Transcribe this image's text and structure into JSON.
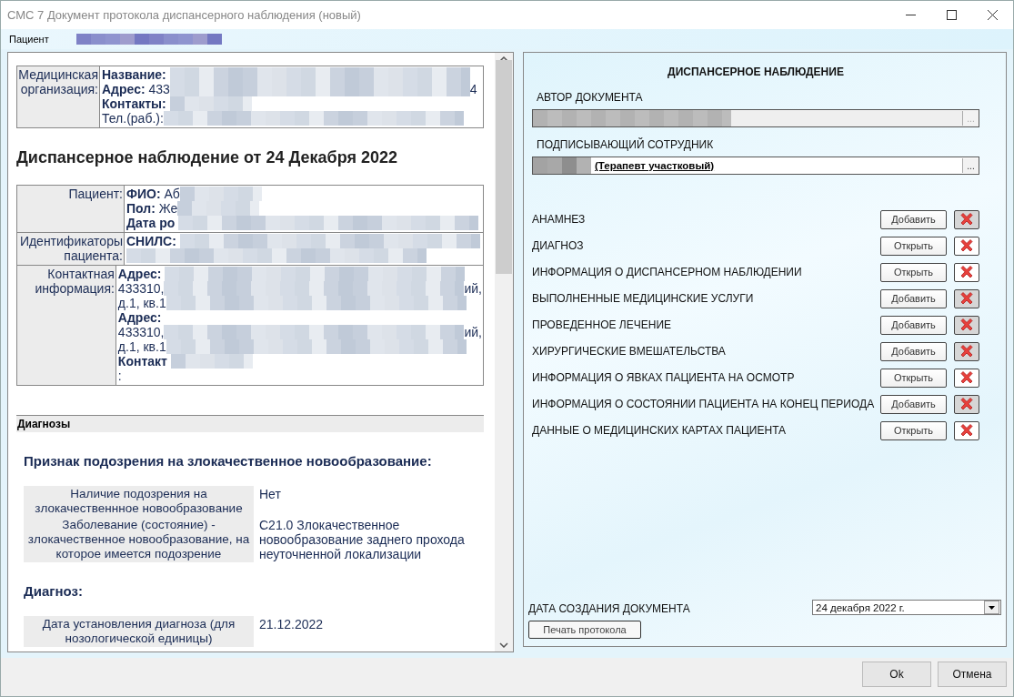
{
  "window": {
    "title": "СМС 7 Документ протокола диспансерного наблюдения (новый)"
  },
  "patient_bar": {
    "label": "Пациент",
    "name_redacted": true
  },
  "document": {
    "org_table": {
      "rows": [
        {
          "label": "Медицинская организация:",
          "lines": [
            {
              "key": "Название:",
              "redacted": true
            },
            {
              "key": "Адрес:",
              "text": "433",
              "redacted": true,
              "after": "4"
            },
            {
              "key": "Контакты:",
              "redacted": true,
              "narrow": true
            },
            {
              "text": "Тел.(раб.):",
              "redacted": true
            }
          ]
        }
      ]
    },
    "heading": "Диспансерное наблюдение от 24 Декабря 2022",
    "patient_table": {
      "rows": [
        {
          "label": "Пациент:",
          "lines": [
            {
              "key": "ФИО:",
              "text": "Аб",
              "redacted": true,
              "narrow": true
            },
            {
              "key": "Пол:",
              "text": "Же",
              "redacted": true,
              "narrow": true
            },
            {
              "key": "Дата ро",
              "redacted": true
            }
          ]
        },
        {
          "label": "Идентификаторы пациента:",
          "lines": [
            {
              "key": "СНИЛС:",
              "redacted": true
            },
            {
              "redacted": true
            }
          ]
        },
        {
          "label": "Контактная информация:",
          "lines": [
            {
              "key": "Адрес:",
              "redacted": true
            },
            {
              "text": "433310,",
              "redacted": true,
              "after": "ий,"
            },
            {
              "text": "д.1, кв.1",
              "redacted": true
            },
            {
              "key": "Адрес:",
              "redacted": false
            },
            {
              "text": "433310,",
              "redacted": true,
              "after": "ий,"
            },
            {
              "text": "д.1, кв.1",
              "redacted": true
            },
            {
              "key": "Контакт",
              "redacted": true,
              "narrow": true
            },
            {
              "text": ":",
              "redacted": false
            }
          ]
        }
      ]
    },
    "section_bar": "Диагнозы",
    "blocks": [
      {
        "title": "Признак подозрения на злокачественное новообразование:",
        "rows": [
          {
            "label": "Наличие подозрения на злокачественнное новообразование",
            "value": "Нет"
          },
          {
            "label": "Заболевание (состояние) - злокачественное новообразование, на которое имеется подозрение",
            "value": "C21.0 Злокачественное новообразование заднего прохода неуточненной локализации"
          }
        ]
      },
      {
        "title": "Диагноз:",
        "rows": [
          {
            "label": "Дата установления диагноза (для нозологической единицы)",
            "value": "21.12.2022"
          }
        ]
      }
    ]
  },
  "form": {
    "title": "ДИСПАНСЕРНОЕ НАБЛЮДЕНИЕ",
    "author": {
      "label": "АВТОР ДОКУМЕНТА",
      "browse": "...",
      "disabled": true
    },
    "signer": {
      "label": "ПОДПИСЫВАЮЩИЙ СОТРУДНИК",
      "value": "(Терапевт участковый)",
      "browse": "...",
      "disabled": false
    },
    "sections": [
      {
        "label": "АНАМНЕЗ",
        "action": "Добавить",
        "delete_disabled": true
      },
      {
        "label": "ДИАГНОЗ",
        "action": "Открыть",
        "delete_disabled": false
      },
      {
        "label": "ИНФОРМАЦИЯ О ДИСПАНСЕРНОМ НАБЛЮДЕНИИ",
        "action": "Открыть",
        "delete_disabled": false
      },
      {
        "label": "ВЫПОЛНЕННЫЕ МЕДИЦИНСКИЕ УСЛУГИ",
        "action": "Добавить",
        "delete_disabled": true
      },
      {
        "label": "ПРОВЕДЕННОЕ ЛЕЧЕНИЕ",
        "action": "Добавить",
        "delete_disabled": true
      },
      {
        "label": "ХИРУРГИЧЕСКИЕ ВМЕШАТЕЛЬСТВА",
        "action": "Добавить",
        "delete_disabled": true
      },
      {
        "label": "ИНФОРМАЦИЯ О ЯВКАХ ПАЦИЕНТА НА ОСМОТР",
        "action": "Открыть",
        "delete_disabled": false
      },
      {
        "label": "ИНФОРМАЦИЯ О СОСТОЯНИИ ПАЦИЕНТА НА КОНЕЦ ПЕРИОДА",
        "action": "Добавить",
        "delete_disabled": true
      },
      {
        "label": "ДАННЫЕ О МЕДИЦИНСКИХ КАРТАХ ПАЦИЕНТА",
        "action": "Открыть",
        "delete_disabled": false
      }
    ],
    "date": {
      "label": "ДАТА СОЗДАНИЯ ДОКУМЕНТА",
      "value": "24 декабря  2022 г."
    },
    "print_button": "Печать протокола"
  },
  "footer": {
    "buttons": [
      "Ok",
      "Отмена"
    ]
  }
}
